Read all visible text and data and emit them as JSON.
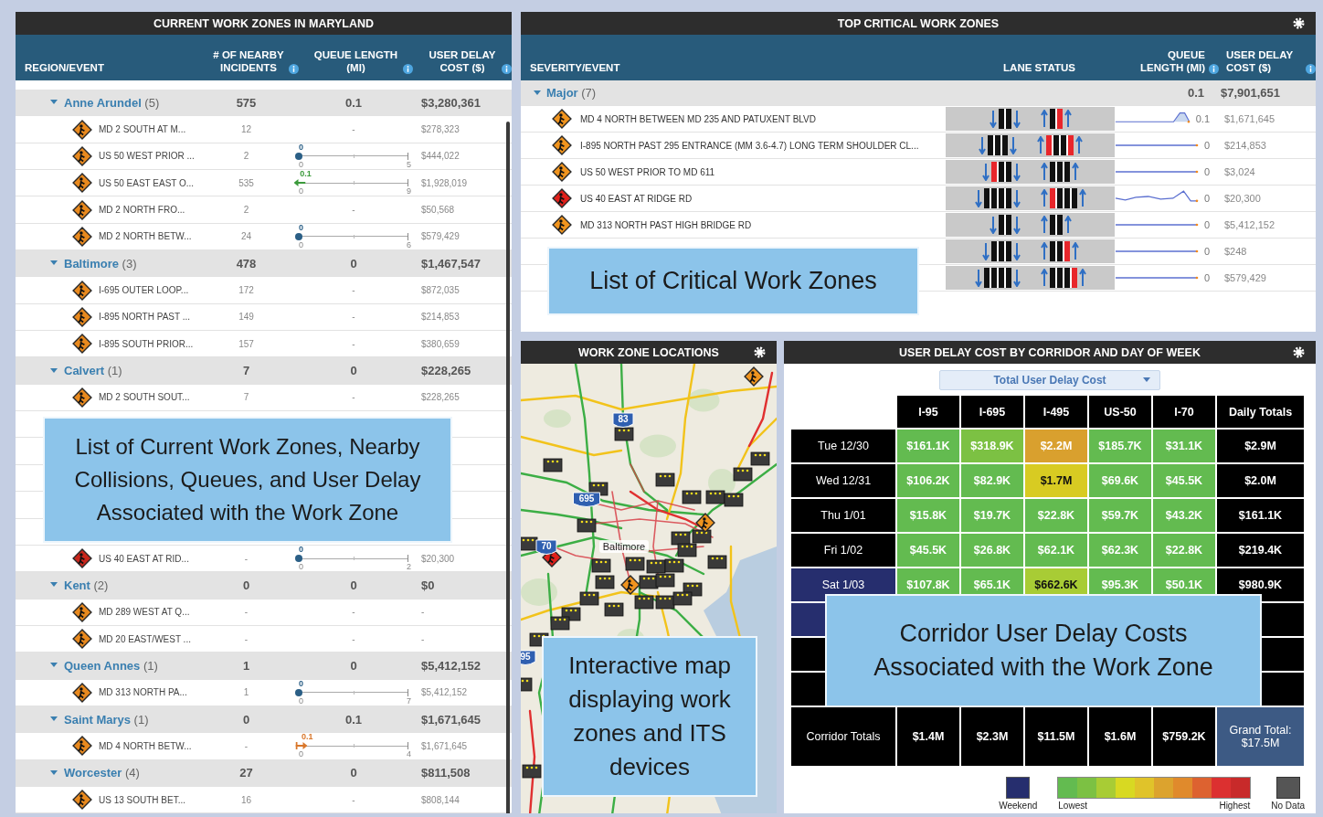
{
  "zones": {
    "title": "CURRENT WORK ZONES IN MARYLAND",
    "columns": [
      {
        "label": "REGION/EVENT"
      },
      {
        "label": "# OF NEARBY INCIDENTS",
        "info": true
      },
      {
        "label": "QUEUE LENGTH (MI)",
        "info": true
      },
      {
        "label": "USER DELAY COST ($)",
        "info": true
      }
    ],
    "rows": [
      {
        "kind": "group",
        "name": "**Anne Arundel** (5)",
        "expanded": true,
        "incidents": "575",
        "queue": "0.1",
        "cost": "$3,280,361"
      },
      {
        "kind": "event",
        "color": "#e8891e",
        "name": "MD 2 SOUTH AT M...",
        "incidents": "12",
        "queue": {
          "kind": "dash",
          "text": "-"
        },
        "cost": "$278,323"
      },
      {
        "kind": "event",
        "color": "#e8891e",
        "name": "US 50 WEST PRIOR ...",
        "incidents": "2",
        "queue": {
          "kind": "dot",
          "value": "0",
          "min": "0",
          "max": "5",
          "level": 0,
          "color": "#2b5f86"
        },
        "cost": "$444,022"
      },
      {
        "kind": "event",
        "color": "#e8891e",
        "name": "US 50 EAST EAST O...",
        "incidents": "535",
        "queue": {
          "kind": "left",
          "value": "0.1",
          "min": "0",
          "max": "9",
          "level": 0.011,
          "color": "#3b9a3b"
        },
        "cost": "$1,928,019"
      },
      {
        "kind": "event",
        "color": "#e8891e",
        "name": "MD 2 NORTH FRO...",
        "incidents": "2",
        "queue": {
          "kind": "dash",
          "text": "-"
        },
        "cost": "$50,568"
      },
      {
        "kind": "event",
        "color": "#e8891e",
        "name": "MD 2 NORTH BETW...",
        "incidents": "24",
        "queue": {
          "kind": "dot",
          "value": "0",
          "min": "0",
          "max": "6",
          "level": 0,
          "color": "#2b5f86"
        },
        "cost": "$579,429"
      },
      {
        "kind": "group",
        "name": "**Baltimore** (3)",
        "expanded": true,
        "incidents": "478",
        "queue": "0",
        "cost": "$1,467,547"
      },
      {
        "kind": "event",
        "color": "#e8891e",
        "name": "I-695 OUTER LOOP...",
        "incidents": "172",
        "queue": {
          "kind": "dash",
          "text": "-"
        },
        "cost": "$872,035"
      },
      {
        "kind": "event",
        "color": "#e8891e",
        "name": "I-895 NORTH PAST ...",
        "incidents": "149",
        "queue": {
          "kind": "dash",
          "text": "-"
        },
        "cost": "$214,853"
      },
      {
        "kind": "event",
        "color": "#e8891e",
        "name": "I-895 SOUTH PRIOR...",
        "incidents": "157",
        "queue": {
          "kind": "dash",
          "text": "-"
        },
        "cost": "$380,659"
      },
      {
        "kind": "group",
        "name": "**Calvert** (1)",
        "expanded": true,
        "incidents": "7",
        "queue": "0",
        "cost": "$228,265"
      },
      {
        "kind": "event",
        "color": "#e8891e",
        "name": "MD 2 SOUTH SOUT...",
        "incidents": "7",
        "queue": {
          "kind": "dash",
          "text": "-"
        },
        "cost": "$228,265"
      },
      {
        "kind": "covered"
      },
      {
        "kind": "covered"
      },
      {
        "kind": "covered"
      },
      {
        "kind": "covered"
      },
      {
        "kind": "covered"
      },
      {
        "kind": "event",
        "color": "#c8261c",
        "name": "US 40 EAST AT RID...",
        "incidents": "-",
        "queue": {
          "kind": "dot",
          "value": "0",
          "min": "0",
          "max": "2",
          "level": 0,
          "color": "#2b5f86"
        },
        "cost": "$20,300"
      },
      {
        "kind": "group",
        "name": "**Kent** (2)",
        "expanded": true,
        "incidents": "0",
        "queue": "0",
        "cost": "$0"
      },
      {
        "kind": "event",
        "color": "#e8891e",
        "name": "MD 289 WEST AT Q...",
        "incidents": "-",
        "queue": {
          "kind": "dash",
          "text": "-"
        },
        "cost": "-"
      },
      {
        "kind": "event",
        "color": "#e8891e",
        "name": "MD 20 EAST/WEST ...",
        "incidents": "-",
        "queue": {
          "kind": "dash",
          "text": "-"
        },
        "cost": "-"
      },
      {
        "kind": "group",
        "name": "**Queen Annes** (1)",
        "expanded": true,
        "incidents": "1",
        "queue": "0",
        "cost": "$5,412,152"
      },
      {
        "kind": "event",
        "color": "#e8891e",
        "name": "MD 313 NORTH PA...",
        "incidents": "1",
        "queue": {
          "kind": "dot",
          "value": "0",
          "min": "0",
          "max": "7",
          "level": 0,
          "color": "#2b5f86"
        },
        "cost": "$5,412,152"
      },
      {
        "kind": "group",
        "name": "**Saint Marys** (1)",
        "expanded": true,
        "incidents": "0",
        "queue": "0.1",
        "cost": "$1,671,645"
      },
      {
        "kind": "event",
        "color": "#e8891e",
        "name": "MD 4 NORTH BETW...",
        "incidents": "-",
        "queue": {
          "kind": "right",
          "value": "0.1",
          "min": "0",
          "max": "4",
          "level": 0.025,
          "color": "#d9772b"
        },
        "cost": "$1,671,645"
      },
      {
        "kind": "group",
        "name": "**Worcester** (4)",
        "expanded": true,
        "incidents": "27",
        "queue": "0",
        "cost": "$811,508"
      },
      {
        "kind": "event",
        "color": "#e8891e",
        "name": "US 13 SOUTH BET...",
        "incidents": "16",
        "queue": {
          "kind": "dash",
          "text": "-"
        },
        "cost": "$808,144"
      }
    ],
    "callout": "List of Current Work Zones, Nearby Collisions, Queues, and User Delay Associated with the Work Zone"
  },
  "critical": {
    "title": "TOP CRITICAL WORK ZONES",
    "settings": true,
    "columns": [
      {
        "label": "SEVERITY/EVENT"
      },
      {
        "label": "LANE STATUS"
      },
      {
        "label": "QUEUE LENGTH (MI)",
        "info": true
      },
      {
        "label": "USER DELAY COST ($)",
        "info": true
      }
    ],
    "group": {
      "name": "**Major** (7)",
      "expanded": true,
      "queue": "0.1",
      "cost": "$7,901,651"
    },
    "rows": [
      {
        "name": "MD 4 NORTH BETWEEN MD 235 AND PATUXENT BLVD",
        "color": "#f0941e",
        "lanes_left": [
          {
            "closed": false
          },
          {
            "closed": false
          }
        ],
        "lanes_right": [
          {
            "closed": false
          },
          {
            "closed": true
          }
        ],
        "kind": "peak",
        "queue": "0.1",
        "cost": "$1,671,645"
      },
      {
        "name": "I-895 NORTH PAST 295 ENTRANCE (MM 3.6-4.7) LONG TERM SHOULDER CL...",
        "color": "#f0941e",
        "lanes_left": [
          {
            "closed": false
          },
          {
            "closed": false
          },
          {
            "closed": false
          }
        ],
        "lanes_right": [
          {
            "closed": true
          },
          {
            "closed": false
          },
          {
            "closed": false
          },
          {
            "closed": true
          }
        ],
        "kind": "flat",
        "queue": "0",
        "cost": "$214,853"
      },
      {
        "name": "US 50 WEST PRIOR TO MD 611",
        "color": "#f0941e",
        "lanes_left": [
          {
            "closed": true
          },
          {
            "closed": false
          },
          {
            "closed": false
          }
        ],
        "lanes_right": [
          {
            "closed": false
          },
          {
            "closed": false
          },
          {
            "closed": false
          }
        ],
        "kind": "flat",
        "queue": "0",
        "cost": "$3,024"
      },
      {
        "name": "US 40 EAST AT RIDGE RD",
        "color": "#e0201b",
        "lanes_left": [
          {
            "closed": false
          },
          {
            "closed": false
          },
          {
            "closed": false
          },
          {
            "closed": false
          }
        ],
        "lanes_right": [
          {
            "closed": true
          },
          {
            "closed": false
          },
          {
            "closed": false
          },
          {
            "closed": false
          }
        ],
        "kind": "wave",
        "queue": "0",
        "cost": "$20,300"
      },
      {
        "name": "MD 313 NORTH PAST HIGH BRIDGE RD",
        "color": "#f0941e",
        "lanes_left": [
          {
            "closed": false
          },
          {
            "closed": false
          }
        ],
        "lanes_right": [
          {
            "closed": false
          },
          {
            "closed": false
          }
        ],
        "kind": "flat",
        "queue": "0",
        "cost": "$5,412,152"
      },
      {
        "lanes_left": [
          {
            "closed": false
          },
          {
            "closed": false
          },
          {
            "closed": false
          }
        ],
        "lanes_right": [
          {
            "closed": false
          },
          {
            "closed": false
          },
          {
            "closed": true
          }
        ],
        "kind": "flat",
        "queue": "0",
        "cost": "$248"
      },
      {
        "lanes_left": [
          {
            "closed": false
          },
          {
            "closed": false
          },
          {
            "closed": false
          },
          {
            "closed": false
          }
        ],
        "lanes_right": [
          {
            "closed": false
          },
          {
            "closed": false
          },
          {
            "closed": false
          },
          {
            "closed": true
          }
        ],
        "kind": "flat",
        "queue": "0",
        "cost": "$579,429"
      }
    ],
    "callout": "List of Critical Work Zones"
  },
  "map": {
    "title": "WORK ZONE LOCATIONS",
    "settings": true,
    "city": "Baltimore",
    "shields": [
      "83",
      "695",
      "70",
      "95"
    ],
    "callout": "Interactive map displaying work zones and ITS devices"
  },
  "heatmap": {
    "title": "USER DELAY COST BY CORRIDOR AND DAY OF WEEK",
    "settings": true,
    "dropdown": "Total User Delay Cost",
    "columns": [
      "I-95",
      "I-695",
      "I-495",
      "US-50",
      "I-70",
      "Daily Totals"
    ],
    "rows": [
      {
        "kind": "day",
        "day": "Tue 12/30",
        "weekend": false,
        "cells": [
          {
            "value": "$161.1K",
            "color": "#63bb50"
          },
          {
            "value": "$318.9K",
            "color": "#7cc143"
          },
          {
            "value": "$2.2M",
            "color": "#d9a02e"
          },
          {
            "value": "$185.7K",
            "color": "#63bb50"
          },
          {
            "value": "$31.1K",
            "color": "#63bb50"
          }
        ],
        "total": "$2.9M"
      },
      {
        "kind": "day",
        "day": "Wed 12/31",
        "weekend": false,
        "cells": [
          {
            "value": "$106.2K",
            "color": "#63bb50"
          },
          {
            "value": "$82.9K",
            "color": "#63bb50"
          },
          {
            "value": "$1.7M",
            "color": "#d8cb22"
          },
          {
            "value": "$69.6K",
            "color": "#63bb50"
          },
          {
            "value": "$45.5K",
            "color": "#63bb50"
          }
        ],
        "total": "$2.0M"
      },
      {
        "kind": "day",
        "day": "Thu 1/01",
        "weekend": false,
        "cells": [
          {
            "value": "$15.8K",
            "color": "#63bb50"
          },
          {
            "value": "$19.7K",
            "color": "#63bb50"
          },
          {
            "value": "$22.8K",
            "color": "#63bb50"
          },
          {
            "value": "$59.7K",
            "color": "#63bb50"
          },
          {
            "value": "$43.2K",
            "color": "#63bb50"
          }
        ],
        "total": "$161.1K"
      },
      {
        "kind": "day",
        "day": "Fri 1/02",
        "weekend": false,
        "cells": [
          {
            "value": "$45.5K",
            "color": "#63bb50"
          },
          {
            "value": "$26.8K",
            "color": "#63bb50"
          },
          {
            "value": "$62.1K",
            "color": "#63bb50"
          },
          {
            "value": "$62.3K",
            "color": "#63bb50"
          },
          {
            "value": "$22.8K",
            "color": "#63bb50"
          }
        ],
        "total": "$219.4K"
      },
      {
        "kind": "day",
        "day": "Sat 1/03",
        "weekend": true,
        "cells": [
          {
            "value": "$107.8K",
            "color": "#63bb50"
          },
          {
            "value": "$65.1K",
            "color": "#63bb50"
          },
          {
            "value": "$662.6K",
            "color": "#a8cc35"
          },
          {
            "value": "$95.3K",
            "color": "#63bb50"
          },
          {
            "value": "$50.1K",
            "color": "#63bb50"
          }
        ],
        "total": "$980.9K"
      },
      {
        "kind": "covered",
        "weekend": true
      },
      {
        "kind": "covered",
        "weekend": false
      },
      {
        "kind": "covered",
        "weekend": false
      }
    ],
    "totals": {
      "label": "Corridor Totals",
      "values": [
        "$1.4M",
        "$2.3M",
        "$11.5M",
        "$1.6M",
        "$759.2K"
      ],
      "grand": "Grand Total: $17.5M"
    },
    "legend": {
      "weekend": "Weekend",
      "low": "Lowest",
      "high": "Highest",
      "no_data": "No Data"
    },
    "callout": "Corridor User Delay Costs Associated with the Work Zone"
  }
}
